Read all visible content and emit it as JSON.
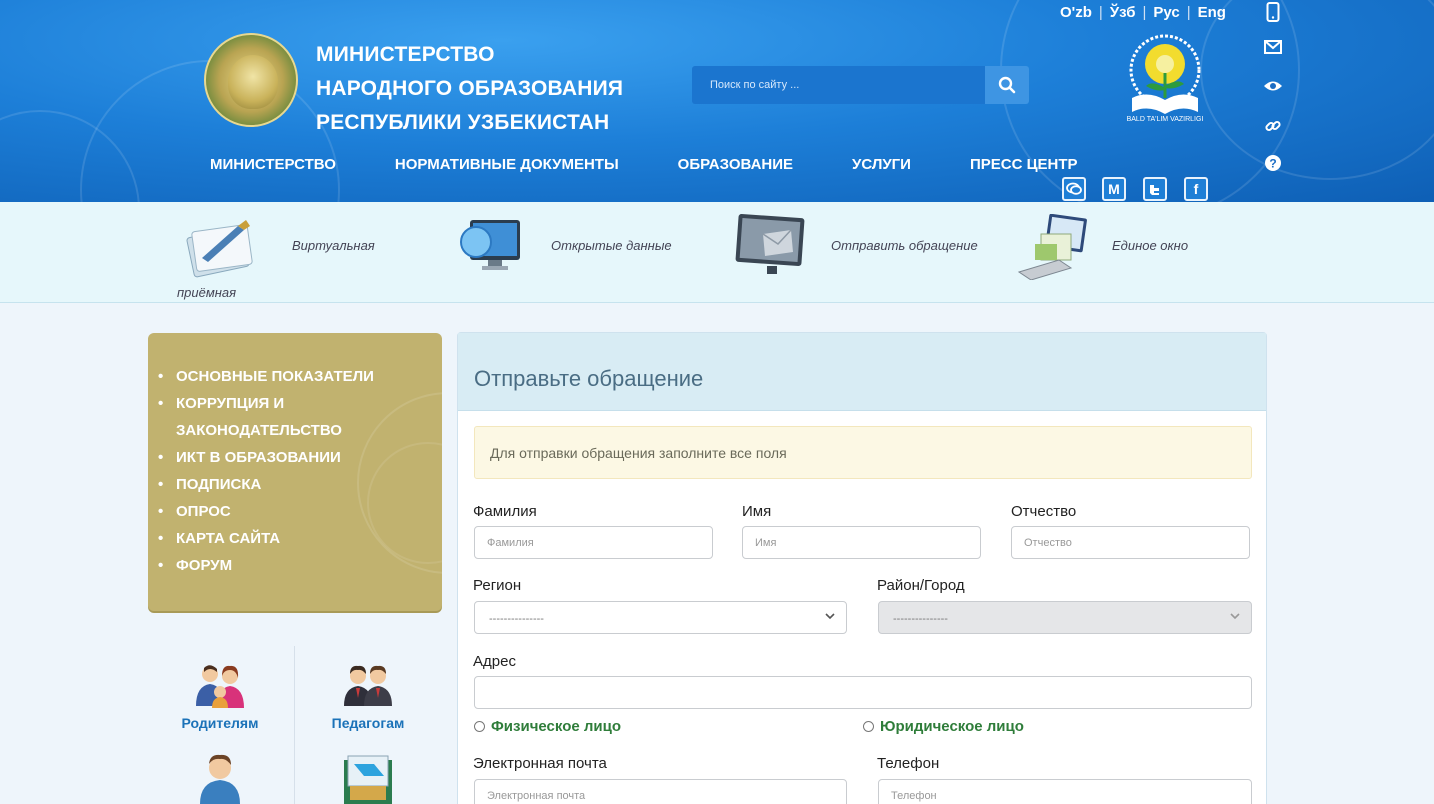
{
  "header": {
    "ministry_lines": [
      "Министерство",
      "народного образования",
      "Республики Узбекистан"
    ],
    "search_placeholder": "Поиск по сайту ...",
    "languages": [
      "O'zb",
      "Ўзб",
      "Рус",
      "Eng"
    ],
    "logo_caption": "BALD TA'LIM VAZIRLIGI",
    "nav": [
      "Министерство",
      "Нормативные документы",
      "Образование",
      "Услуги",
      "Пресс центр"
    ],
    "side_icons": [
      "mobile-icon",
      "mail-icon",
      "eye-icon",
      "link-icon",
      "question-icon"
    ],
    "social": [
      "chat-icon",
      "M",
      "twitter-icon",
      "f"
    ]
  },
  "quick_links": [
    {
      "label": "Виртуальная",
      "label2": "приёмная"
    },
    {
      "label": "Открытые данные"
    },
    {
      "label": "Отправить обращение"
    },
    {
      "label": "Единое окно"
    }
  ],
  "sidebar": {
    "items": [
      "Основные показатели",
      "Коррупция и законодательство",
      "ИКТ в образовании",
      "Подписка",
      "Опрос",
      "Карта сайта",
      "Форум"
    ],
    "roles": [
      "Родителям",
      "Педагогам"
    ]
  },
  "form": {
    "title": "Отправьте обращение",
    "notice": "Для отправки обращения заполните все поля",
    "lastname_label": "Фамилия",
    "lastname_placeholder": "Фамилия",
    "firstname_label": "Имя",
    "firstname_placeholder": "Имя",
    "patronymic_label": "Отчество",
    "patronymic_placeholder": "Отчество",
    "region_label": "Регион",
    "region_value": "---------------",
    "district_label": "Район/Город",
    "district_value": "---------------",
    "address_label": "Адрес",
    "person_physical": "Физическое лицо",
    "person_legal": "Юридическое лицо",
    "email_label": "Электронная почта",
    "email_placeholder": "Электронная почта",
    "phone_label": "Телефон",
    "phone_placeholder": "Телефон"
  }
}
